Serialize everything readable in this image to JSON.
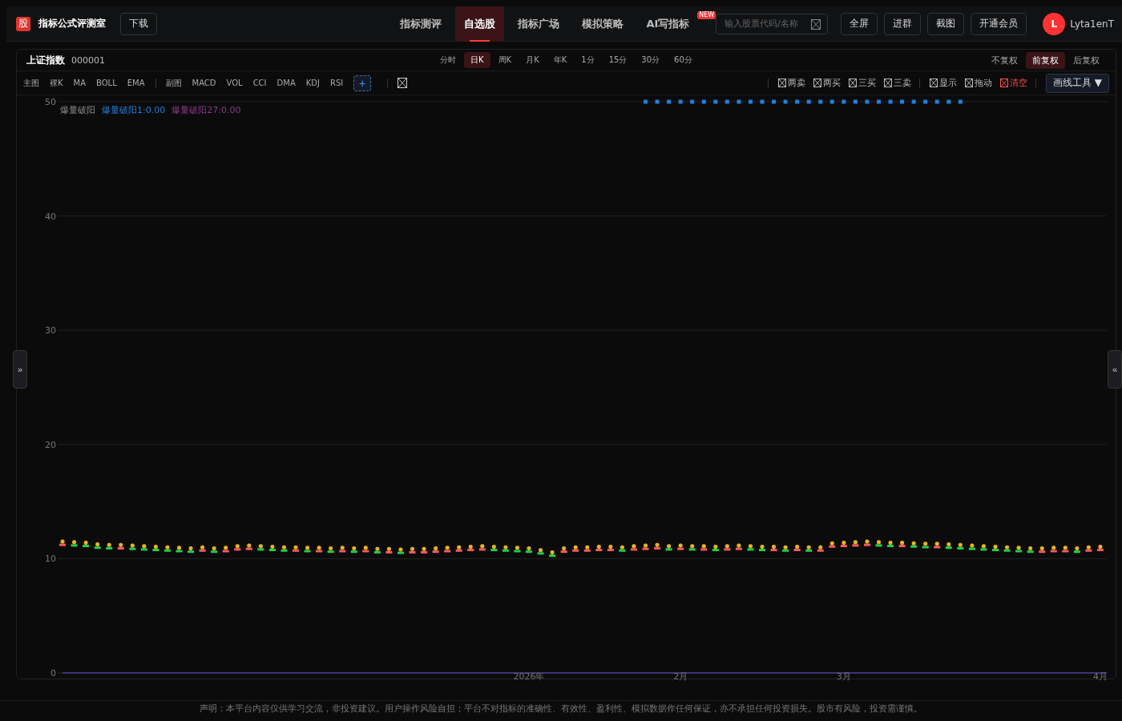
{
  "brand": {
    "logo": "股",
    "name": "指标公式评测室",
    "download": "下载"
  },
  "nav": [
    {
      "label": "指标测评",
      "selected": false
    },
    {
      "label": "自选股",
      "selected": true
    },
    {
      "label": "指标广场",
      "selected": false
    },
    {
      "label": "模拟策略",
      "selected": false
    },
    {
      "label": "AI写指标",
      "selected": false,
      "badge": "NEW"
    }
  ],
  "search": {
    "placeholder": "输入股票代码/名称"
  },
  "actions": [
    "全屏",
    "进群",
    "截图",
    "开通会员"
  ],
  "user": {
    "initial": "L",
    "name": "Lyta1enT"
  },
  "stock": {
    "name": "上证指数",
    "code": "000001"
  },
  "periods": [
    {
      "label": "分时",
      "selected": false
    },
    {
      "label": "日K",
      "selected": true
    },
    {
      "label": "周K",
      "selected": false
    },
    {
      "label": "月K",
      "selected": false
    },
    {
      "label": "年K",
      "selected": false
    },
    {
      "label": "1分",
      "selected": false
    },
    {
      "label": "15分",
      "selected": false
    },
    {
      "label": "30分",
      "selected": false
    },
    {
      "label": "60分",
      "selected": false
    }
  ],
  "adjust": [
    {
      "label": "不复权",
      "selected": false
    },
    {
      "label": "前复权",
      "selected": true
    },
    {
      "label": "后复权",
      "selected": false
    }
  ],
  "main_indicators": {
    "label": "主图",
    "items": [
      "裸K",
      "MA",
      "BOLL",
      "EMA"
    ]
  },
  "sub_indicators": {
    "label": "副图",
    "items": [
      "MACD",
      "VOL",
      "CCI",
      "DMA",
      "KDJ",
      "RSI"
    ]
  },
  "add_button": "+",
  "signals": [
    "两卖",
    "两买",
    "三买",
    "三卖"
  ],
  "tools": [
    {
      "label": "显示",
      "kind": "normal"
    },
    {
      "label": "拖动",
      "kind": "normal"
    },
    {
      "label": "清空",
      "kind": "danger"
    }
  ],
  "draw_tools": "画线工具 ▼",
  "legend": [
    {
      "label": "爆量破阳",
      "color": "#8a8a8a"
    },
    {
      "label": "爆量破阳1:0.00",
      "color": "#1e7fd6"
    },
    {
      "label": "爆量破阳27:0.00",
      "color": "#8a3a8a"
    }
  ],
  "chart_data": {
    "type": "scatter",
    "grid": true,
    "ylim": [
      0,
      50
    ],
    "yticks": [
      0,
      10,
      20,
      30,
      40,
      50
    ],
    "series": [
      {
        "color": "#e6b422",
        "values": [
          11.5,
          11.45,
          11.4,
          11.25,
          11.2,
          11.2,
          11.15,
          11.1,
          11.05,
          11.0,
          10.95,
          10.9,
          11.0,
          10.9,
          10.95,
          11.1,
          11.15,
          11.1,
          11.05,
          11.0,
          11.0,
          10.95,
          10.95,
          10.9,
          10.95,
          10.9,
          10.95,
          10.85,
          10.85,
          10.8,
          10.85,
          10.85,
          10.9,
          10.95,
          11.0,
          11.05,
          11.1,
          11.05,
          11.0,
          10.95,
          10.9,
          10.75,
          10.55,
          10.9,
          11.0,
          11.0,
          11.05,
          11.05,
          11.0,
          11.1,
          11.15,
          11.2,
          11.1,
          11.15,
          11.1,
          11.1,
          11.05,
          11.1,
          11.15,
          11.1,
          11.05,
          11.05,
          11.0,
          11.05,
          11.0,
          11.0,
          11.35,
          11.4,
          11.45,
          11.5,
          11.45,
          11.4,
          11.4,
          11.35,
          11.3,
          11.3,
          11.25,
          11.2,
          11.15,
          11.1,
          11.05,
          11.0,
          10.95,
          10.9,
          10.9,
          10.95,
          10.95,
          10.9,
          11.0,
          11.05
        ]
      },
      {
        "color": "#1e7fe0",
        "values": [
          null,
          null,
          null,
          null,
          null,
          null,
          null,
          null,
          null,
          null,
          null,
          null,
          null,
          null,
          null,
          null,
          null,
          null,
          null,
          null,
          null,
          null,
          null,
          null,
          null,
          null,
          null,
          null,
          null,
          null,
          null,
          null,
          null,
          null,
          null,
          null,
          null,
          null,
          null,
          null,
          null,
          null,
          null,
          null,
          null,
          null,
          null,
          null,
          null,
          null,
          50,
          50,
          50,
          50,
          50,
          50,
          50,
          50,
          50,
          50,
          50,
          50,
          50,
          50,
          50,
          50,
          50,
          50,
          50,
          50,
          50,
          50,
          50,
          50,
          50,
          50,
          50,
          50,
          null,
          null,
          null,
          null,
          null,
          null,
          null,
          null,
          null,
          null,
          null,
          null
        ]
      }
    ]
  },
  "x_axis_labels": [
    "2026年",
    "2月",
    "3月",
    "4月"
  ],
  "left_handle": "»",
  "right_handle": "«",
  "disclaimer": "声明：本平台内容仅供学习交流，非投资建议。用户操作风险自担；平台不对指标的准确性、有效性、盈利性、模拟数据作任何保证，亦不承担任何投资损失。股市有风险，投资需谨慎。"
}
